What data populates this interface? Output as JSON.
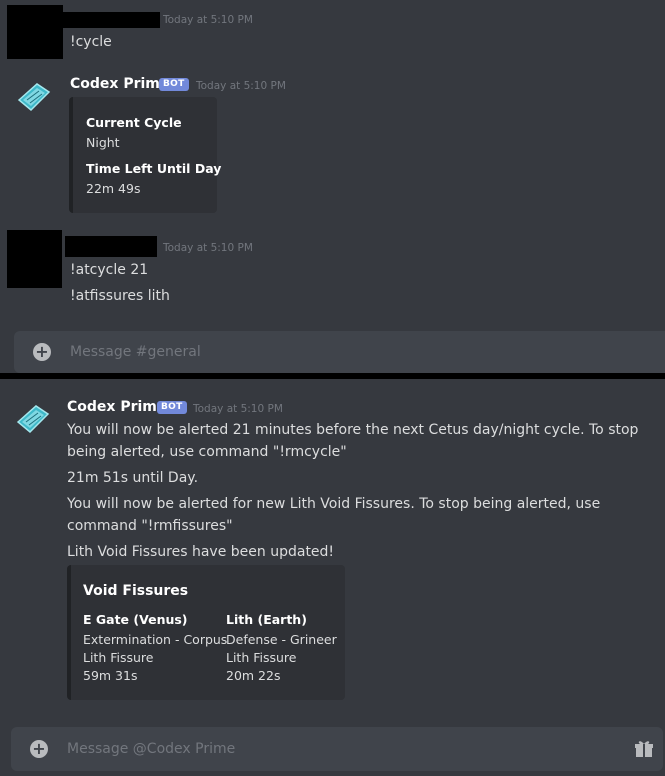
{
  "colors": {
    "background": "#36393f",
    "bot_badge": "#7289da",
    "embed_bg": "#2f3136",
    "input_bg": "#40444b"
  },
  "messages": [
    {
      "timestamp": "Today at 5:10 PM",
      "lines": [
        "!cycle"
      ]
    },
    {
      "author": "Codex Prime",
      "badge": "BOT",
      "timestamp": "Today at 5:10 PM",
      "embed": {
        "fields": [
          {
            "name": "Current Cycle",
            "value": "Night"
          },
          {
            "name": "Time Left Until Day",
            "value": "22m 49s"
          }
        ]
      }
    },
    {
      "timestamp": "Today at 5:10 PM",
      "lines": [
        "!atcycle 21",
        "!atfissures lith"
      ]
    }
  ],
  "input_top": {
    "placeholder": "Message #general"
  },
  "panel2": {
    "author": "Codex Prime",
    "badge": "BOT",
    "timestamp": "Today at 5:10 PM",
    "lines": [
      "You will now be alerted 21 minutes before the next Cetus day/night cycle. To stop being alerted, use command \"!rmcycle\"",
      "21m 51s until Day.",
      "You will now be alerted for new Lith Void Fissures. To stop being alerted, use command \"!rmfissures\"",
      "Lith Void Fissures have been updated!"
    ],
    "embed": {
      "title": "Void Fissures",
      "columns": [
        {
          "name": "E Gate (Venus)",
          "values": [
            "Extermination - Corpus",
            "Lith Fissure",
            "59m 31s"
          ]
        },
        {
          "name": "Lith (Earth)",
          "values": [
            "Defense - Grineer",
            "Lith Fissure",
            "20m 22s"
          ]
        }
      ]
    },
    "input": {
      "placeholder": "Message @Codex Prime"
    }
  },
  "icons": {
    "plus": "plus-circle-icon",
    "gift": "gift-icon",
    "avatar": "codex-avatar-icon"
  }
}
